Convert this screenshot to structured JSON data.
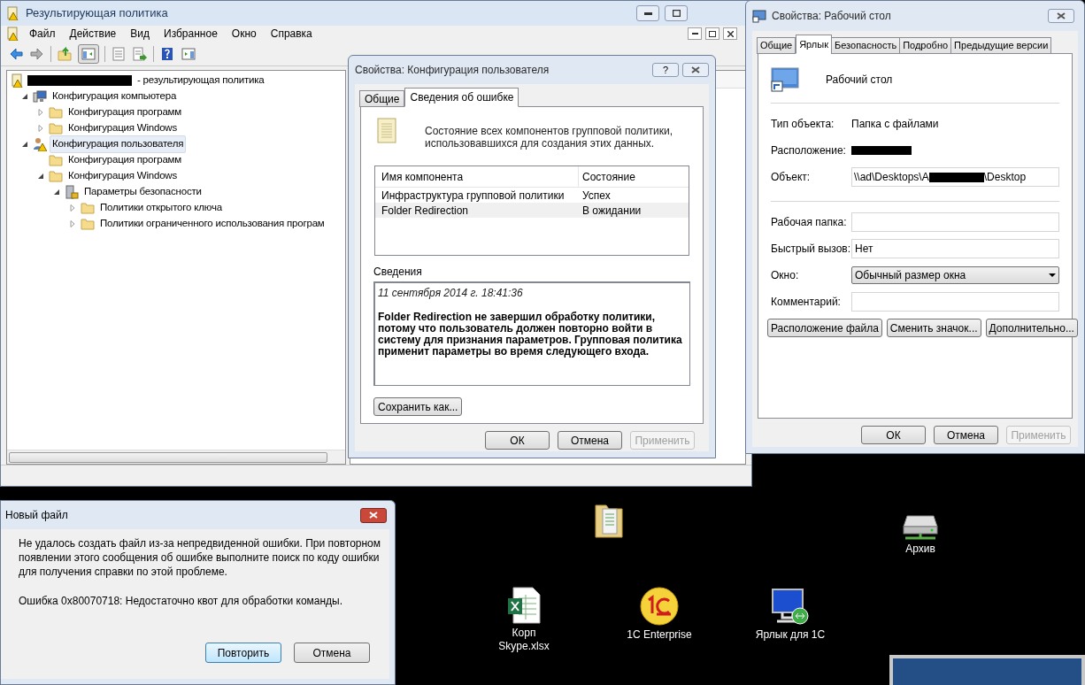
{
  "mmc_window": {
    "title": "Результирующая политика",
    "menu": [
      "Файл",
      "Действие",
      "Вид",
      "Избранное",
      "Окно",
      "Справка"
    ],
    "tree": [
      {
        "label": "- результирующая политика",
        "kind": "policy",
        "redacted_prefix": true,
        "children": [
          {
            "label": "Конфигурация компьютера",
            "kind": "computer",
            "expanded": true,
            "selected": false,
            "children": [
              {
                "label": "Конфигурация программ",
                "kind": "folder",
                "expanded": false,
                "selected": false
              },
              {
                "label": "Конфигурация Windows",
                "kind": "folder",
                "expanded": false,
                "selected": false
              }
            ]
          },
          {
            "label": "Конфигурация пользователя",
            "kind": "user",
            "expanded": true,
            "selected": true,
            "children": [
              {
                "label": "Конфигурация программ",
                "kind": "folder",
                "selected": false
              },
              {
                "label": "Конфигурация Windows",
                "kind": "folder",
                "expanded": true,
                "selected": false,
                "children": [
                  {
                    "label": "Параметры безопасности",
                    "kind": "security",
                    "expanded": true,
                    "selected": false,
                    "children": [
                      {
                        "label": "Политики открытого ключа",
                        "kind": "folder",
                        "expanded": false,
                        "selected": false
                      },
                      {
                        "label": "Политики ограниченного использования програм",
                        "kind": "folder",
                        "expanded": false,
                        "selected": false
                      }
                    ]
                  }
                ]
              }
            ]
          }
        ]
      }
    ]
  },
  "policy_dialog": {
    "title": "Свойства: Конфигурация пользователя",
    "help": "?",
    "tabs": [
      {
        "label": "Общие",
        "selected": false
      },
      {
        "label": "Сведения об ошибке",
        "selected": true
      }
    ],
    "description": "Состояние всех компонентов групповой политики, использовавшихся для создания этих данных.",
    "columns": [
      "Имя компонента",
      "Состояние"
    ],
    "rows": [
      {
        "cells": [
          "Инфраструктура групповой политики",
          "Успех"
        ],
        "selected": false
      },
      {
        "cells": [
          "Folder Redirection",
          "В ожидании"
        ],
        "selected": true
      }
    ],
    "details_label": "Сведения",
    "details_date": "11 сентября 2014 г. 18:41:36",
    "details_message": "Folder Redirection не завершил обработку политики, потому что пользователь должен повторно войти в систему для признания параметров. Групповая политика применит параметры во время следующего входа.",
    "save_button": "Сохранить как...",
    "buttons": [
      {
        "label": "ОК",
        "disabled": false
      },
      {
        "label": "Отмена",
        "disabled": false
      },
      {
        "label": "Применить",
        "disabled": true
      }
    ]
  },
  "shortcut_dialog": {
    "title": "Свойства: Рабочий стол",
    "tabs": [
      {
        "label": "Общие",
        "selected": false
      },
      {
        "label": "Ярлык",
        "selected": true
      },
      {
        "label": "Безопасность",
        "selected": false
      },
      {
        "label": "Подробно",
        "selected": false
      },
      {
        "label": "Предыдущие версии",
        "selected": false
      }
    ],
    "name": "Рабочий стол",
    "fields": [
      {
        "kind": "text",
        "label": "Тип объекта:",
        "value": "Папка с файлами"
      },
      {
        "kind": "redacted",
        "label": "Расположение:"
      },
      {
        "kind": "redacted_input",
        "label": "Объект:",
        "value_start": "\\\\ad\\Desktops\\А",
        "value_end": "\\Desktop"
      },
      {
        "kind": "divider"
      },
      {
        "kind": "input",
        "label": "Рабочая папка:"
      },
      {
        "kind": "input",
        "label": "Быстрый вызов:",
        "value": "Нет"
      },
      {
        "kind": "select",
        "label": "Окно:",
        "value": "Обычный размер окна"
      },
      {
        "kind": "input",
        "label": "Комментарий:"
      }
    ],
    "actions": [
      "Расположение файла",
      "Сменить значок...",
      "Дополнительно..."
    ],
    "buttons": [
      {
        "label": "ОК",
        "disabled": false
      },
      {
        "label": "Отмена",
        "disabled": false
      },
      {
        "label": "Применить",
        "disabled": true
      }
    ]
  },
  "error_dialog": {
    "title": "Новый файл",
    "message": "Не удалось создать файл из-за непредвиденной ошибки. При повторном появлении этого сообщения об ошибке выполните поиск по коду ошибки для получения справки по этой проблеме.",
    "error": "Ошибка 0x80070718: Недостаточно квот для обработки команды.",
    "buttons": [
      {
        "label": "Повторить",
        "default": true
      },
      {
        "label": "Отмена",
        "default": false
      }
    ]
  },
  "desktop": {
    "icons": [
      {
        "kind": "folder"
      },
      {
        "kind": "drive",
        "label": "Архив"
      },
      {
        "kind": "excel",
        "label": "Корп Skype.xlsx"
      },
      {
        "kind": "onec",
        "label": "1C Enterprise"
      },
      {
        "kind": "remote",
        "label": "Ярлык для 1С"
      }
    ]
  }
}
